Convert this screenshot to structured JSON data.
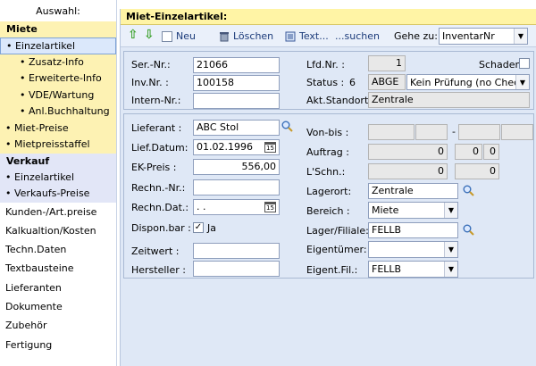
{
  "sidebar": {
    "title": "Auswahl:",
    "miete_label": "Miete",
    "miete_items": [
      "• Einzelartikel",
      "• Zusatz-Info",
      "• Erweiterte-Info",
      "• VDE/Wartung",
      "• Anl.Buchhaltung",
      "• Miet-Preise",
      "• Mietpreisstaffel"
    ],
    "verkauf_label": "Verkauf",
    "verkauf_items": [
      "• Einzelartikel",
      "• Verkaufs-Preise"
    ],
    "plain_items": [
      "Kunden-/Art.preise",
      "Kalkualtion/Kosten",
      "Techn.Daten",
      "Textbausteine",
      "Lieferanten",
      "Dokumente",
      "Zubehör",
      "Fertigung"
    ]
  },
  "main": {
    "title": "Miet-Einzelartikel:"
  },
  "toolbar": {
    "neu": "Neu",
    "loeschen": "Löschen",
    "text": "Text...",
    "suchen": "...suchen",
    "gehe_zu": "Gehe zu:",
    "gehe_zu_value": "InventarNr"
  },
  "top": {
    "sernr_label": "Ser.-Nr.:",
    "sernr": "21066",
    "invnr_label": "Inv.Nr. :",
    "invnr": "100158",
    "internnr_label": "Intern-Nr.:",
    "internnr": "",
    "lfdnr_label": "Lfd.Nr. :",
    "lfdnr": "1",
    "schaden_label": "Schaden",
    "status_label": "Status :",
    "status_num": "6",
    "status_code": "ABGE",
    "status_text": "Kein Prüfung (no Check)",
    "standort_label": "Akt.Standort :",
    "standort": "Zentrale"
  },
  "detail": {
    "lieferant_label": "Lieferant :",
    "lieferant": "ABC Stol",
    "liefdatum_label": "Lief.Datum:",
    "liefdatum": "01.02.1996",
    "ekpreis_label": "EK-Preis :",
    "ekpreis": "556,00",
    "rechnnr_label": "Rechn.-Nr.:",
    "rechnnr": "",
    "rechndat_label": "Rechn.Dat.:",
    "rechndat": " .  .",
    "dispon_label": "Dispon.bar :",
    "dispon_value": "Ja",
    "zeitwert_label": "Zeitwert :",
    "zeitwert": "",
    "hersteller_label": "Hersteller :",
    "hersteller": "",
    "vonbis_label": "Von-bis :",
    "vonbis_sep": "-",
    "auftrag_label": "Auftrag :",
    "auftrag_a": "0",
    "auftrag_b": "0",
    "auftrag_c": "0",
    "lschn_label": "L'Schn.:",
    "lschn_a": "0",
    "lschn_b": "0",
    "lagerort_label": "Lagerort:",
    "lagerort": "Zentrale",
    "bereich_label": "Bereich :",
    "bereich": "Miete",
    "lagerfiliale_label": "Lager/Filiale:",
    "lagerfiliale": "FELLB",
    "eigentuemer_label": "Eigentümer:",
    "eigentuemer": "",
    "eigentfil_label": "Eigent.Fil.:",
    "eigentfil": "FELLB"
  },
  "colors": {
    "titlebar": "#fff4a5",
    "miete_bg": "#fdf2b3",
    "verkauf_bg": "#e2e6f7",
    "panel": "#dfe8f6"
  }
}
